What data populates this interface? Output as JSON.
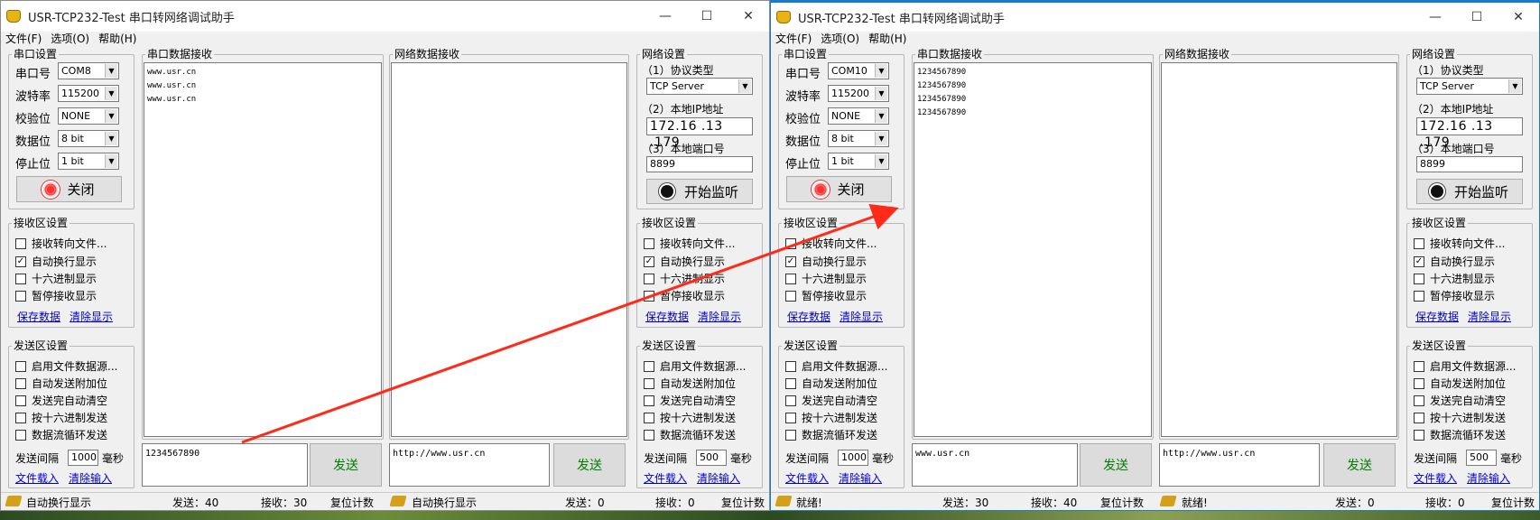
{
  "windows": [
    {
      "title": "USR-TCP232-Test 串口转网络调试助手",
      "menu": [
        "文件(F)",
        "选项(O)",
        "帮助(H)"
      ],
      "serial": {
        "group_title": "串口设置",
        "port_label": "串口号",
        "port_value": "COM8",
        "baud_label": "波特率",
        "baud_value": "115200",
        "parity_label": "校验位",
        "parity_value": "NONE",
        "data_label": "数据位",
        "data_value": "8 bit",
        "stop_label": "停止位",
        "stop_value": "1 bit",
        "button_label": "关闭"
      },
      "serial_recv": {
        "title": "串口数据接收",
        "lines": [
          "www.usr.cn",
          "www.usr.cn",
          "www.usr.cn",
          "",
          ""
        ]
      },
      "net_recv": {
        "title": "网络数据接收",
        "lines": [
          ""
        ]
      },
      "network": {
        "group_title": "网络设置",
        "protocol_label": "（1）协议类型",
        "protocol_value": "TCP Server",
        "ip_label": "（2）本地IP地址",
        "ip_value": "172.16 .13 .179",
        "port_label": "（3）本地端口号",
        "port_value": "8899",
        "listen_label": "开始监听"
      },
      "recv_left": {
        "title": "接收区设置",
        "options": [
          {
            "label": "接收转向文件...",
            "checked": false
          },
          {
            "label": "自动换行显示",
            "checked": true
          },
          {
            "label": "十六进制显示",
            "checked": false
          },
          {
            "label": "暂停接收显示",
            "checked": false
          }
        ],
        "save": "保存数据",
        "clear": "清除显示"
      },
      "send_left": {
        "title": "发送区设置",
        "options": [
          {
            "label": "启用文件数据源...",
            "checked": false
          },
          {
            "label": "自动发送附加位",
            "checked": false
          },
          {
            "label": "发送完自动清空",
            "checked": false
          },
          {
            "label": "按十六进制发送",
            "checked": false
          },
          {
            "label": "数据流循环发送",
            "checked": false
          }
        ],
        "interval_label": "发送间隔",
        "interval_value": "1000",
        "interval_unit": "毫秒",
        "load": "文件载入",
        "clear": "清除输入"
      },
      "recv_right": {
        "title": "接收区设置",
        "options": [
          {
            "label": "接收转向文件...",
            "checked": false
          },
          {
            "label": "自动换行显示",
            "checked": true
          },
          {
            "label": "十六进制显示",
            "checked": false
          },
          {
            "label": "暂停接收显示",
            "checked": false
          }
        ],
        "save": "保存数据",
        "clear": "清除显示"
      },
      "send_right": {
        "title": "发送区设置",
        "options": [
          {
            "label": "启用文件数据源...",
            "checked": false
          },
          {
            "label": "自动发送附加位",
            "checked": false
          },
          {
            "label": "发送完自动清空",
            "checked": false
          },
          {
            "label": "按十六进制发送",
            "checked": false
          },
          {
            "label": "数据流循环发送",
            "checked": false
          }
        ],
        "interval_label": "发送间隔",
        "interval_value": "500",
        "interval_unit": "毫秒",
        "load": "文件载入",
        "clear": "清除输入"
      },
      "serial_send": {
        "text": "1234567890",
        "button": "发送"
      },
      "net_send": {
        "text": "http://www.usr.cn",
        "button": "发送"
      },
      "status": {
        "left_text": "自动换行显示",
        "sent": "发送：40",
        "recv": "接收：30",
        "reset": "复位计数",
        "right_text": "自动换行显示",
        "sent2": "发送：0",
        "recv2": "接收：0",
        "reset2": "复位计数"
      }
    },
    {
      "title": "USR-TCP232-Test 串口转网络调试助手",
      "menu": [
        "文件(F)",
        "选项(O)",
        "帮助(H)"
      ],
      "serial": {
        "group_title": "串口设置",
        "port_label": "串口号",
        "port_value": "COM10",
        "baud_label": "波特率",
        "baud_value": "115200",
        "parity_label": "校验位",
        "parity_value": "NONE",
        "data_label": "数据位",
        "data_value": "8 bit",
        "stop_label": "停止位",
        "stop_value": "1 bit",
        "button_label": "关闭"
      },
      "serial_recv": {
        "title": "串口数据接收",
        "lines": [
          "1234567890",
          "1234567890",
          "1234567890",
          "1234567890",
          ""
        ]
      },
      "net_recv": {
        "title": "网络数据接收",
        "lines": [
          ""
        ]
      },
      "network": {
        "group_title": "网络设置",
        "protocol_label": "（1）协议类型",
        "protocol_value": "TCP Server",
        "ip_label": "（2）本地IP地址",
        "ip_value": "172.16 .13 .179",
        "port_label": "（3）本地端口号",
        "port_value": "8899",
        "listen_label": "开始监听"
      },
      "recv_left": {
        "title": "接收区设置",
        "options": [
          {
            "label": "接收转向文件...",
            "checked": false
          },
          {
            "label": "自动换行显示",
            "checked": true
          },
          {
            "label": "十六进制显示",
            "checked": false
          },
          {
            "label": "暂停接收显示",
            "checked": false
          }
        ],
        "save": "保存数据",
        "clear": "清除显示"
      },
      "send_left": {
        "title": "发送区设置",
        "options": [
          {
            "label": "启用文件数据源...",
            "checked": false
          },
          {
            "label": "自动发送附加位",
            "checked": false
          },
          {
            "label": "发送完自动清空",
            "checked": false
          },
          {
            "label": "按十六进制发送",
            "checked": false
          },
          {
            "label": "数据流循环发送",
            "checked": false
          }
        ],
        "interval_label": "发送间隔",
        "interval_value": "1000",
        "interval_unit": "毫秒",
        "load": "文件载入",
        "clear": "清除输入"
      },
      "recv_right": {
        "title": "接收区设置",
        "options": [
          {
            "label": "接收转向文件...",
            "checked": false
          },
          {
            "label": "自动换行显示",
            "checked": true
          },
          {
            "label": "十六进制显示",
            "checked": false
          },
          {
            "label": "暂停接收显示",
            "checked": false
          }
        ],
        "save": "保存数据",
        "clear": "清除显示"
      },
      "send_right": {
        "title": "发送区设置",
        "options": [
          {
            "label": "启用文件数据源...",
            "checked": false
          },
          {
            "label": "自动发送附加位",
            "checked": false
          },
          {
            "label": "发送完自动清空",
            "checked": false
          },
          {
            "label": "按十六进制发送",
            "checked": false
          },
          {
            "label": "数据流循环发送",
            "checked": false
          }
        ],
        "interval_label": "发送间隔",
        "interval_value": "500",
        "interval_unit": "毫秒",
        "load": "文件载入",
        "clear": "清除输入"
      },
      "serial_send": {
        "text": "www.usr.cn",
        "button": "发送"
      },
      "net_send": {
        "text": "http://www.usr.cn",
        "button": "发送"
      },
      "status": {
        "left_text": "就绪!",
        "sent": "发送：30",
        "recv": "接收：40",
        "reset": "复位计数",
        "right_text": "就绪!",
        "sent2": "发送：0",
        "recv2": "接收：0",
        "reset2": "复位计数"
      }
    }
  ],
  "colors": {
    "arrow": "#ff2a1a",
    "send_text": "#008000",
    "link": "#0000cc",
    "active_border": "#1979ca"
  }
}
